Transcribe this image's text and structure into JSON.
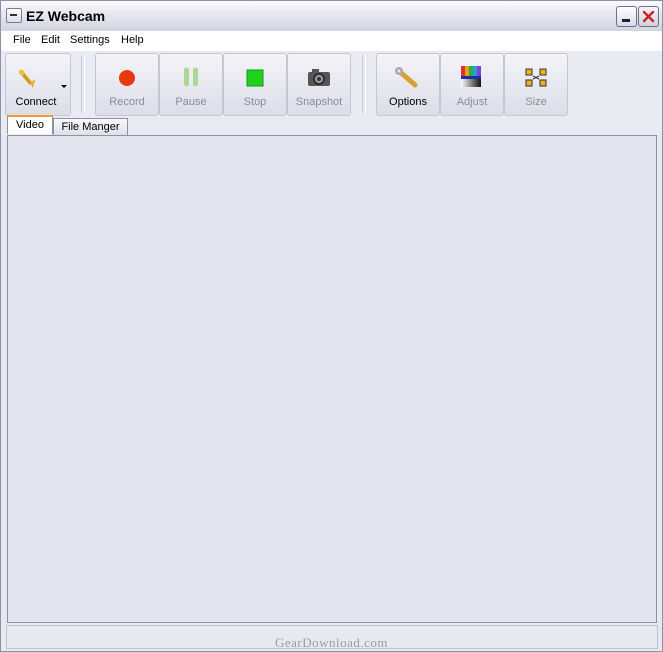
{
  "window": {
    "title": "EZ Webcam"
  },
  "menu": [
    "File",
    "Edit",
    "Settings",
    "Help"
  ],
  "toolbar": {
    "connect": "Connect",
    "record": "Record",
    "pause": "Pause",
    "stop": "Stop",
    "snapshot": "Snapshot",
    "options": "Options",
    "adjust": "Adjust",
    "size": "Size"
  },
  "tabs": [
    "Video",
    "File Manger"
  ],
  "watermark": "GearDownload.com",
  "icons": {
    "connect": "plug-icon",
    "record": "record-icon",
    "pause": "pause-icon",
    "stop": "stop-icon",
    "snapshot": "camera-icon",
    "options": "wrench-icon",
    "adjust": "color-bars-icon",
    "size": "resize-icon"
  },
  "colors": {
    "record": "#e8380f",
    "stop": "#1ed21e",
    "pause": "#a8d898",
    "active_tab_accent": "#f0a030"
  }
}
